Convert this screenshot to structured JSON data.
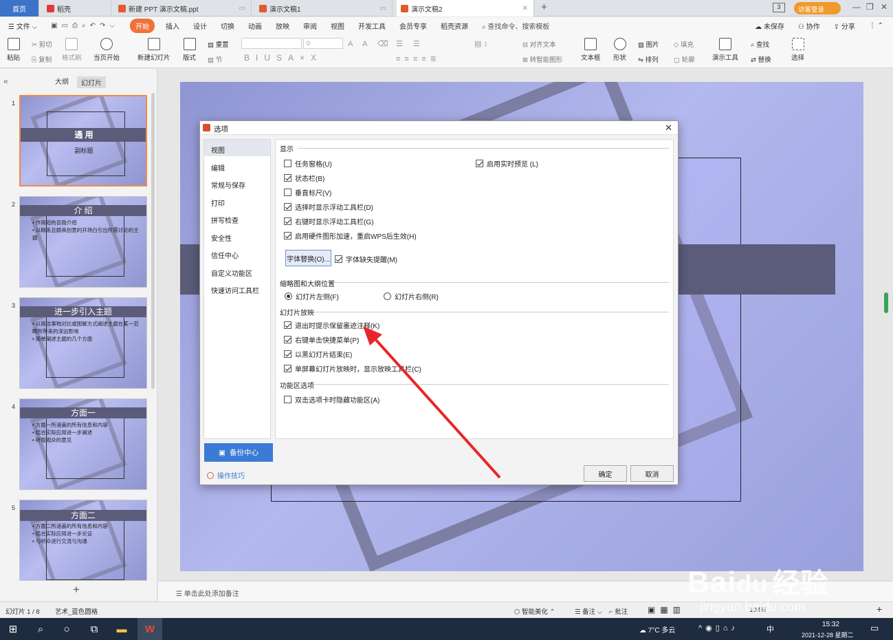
{
  "tabs": [
    {
      "label": "首页"
    },
    {
      "label": "稻壳"
    },
    {
      "label": "新建 PPT 演示文稿.ppt"
    },
    {
      "label": "演示文稿1"
    },
    {
      "label": "演示文稿2"
    }
  ],
  "tabbar_right": {
    "page_badge": "3",
    "login": "访客登录"
  },
  "menu": {
    "file": "文件",
    "tabs": [
      "开始",
      "插入",
      "设计",
      "切换",
      "动画",
      "放映",
      "审阅",
      "视图",
      "开发工具",
      "会员专享",
      "稻壳资源"
    ],
    "search": "查找命令、搜索模板",
    "unsaved": "未保存",
    "collab": "协作",
    "share": "分享"
  },
  "ribbon": {
    "paste": "粘贴",
    "cut": "剪切",
    "copy": "复制",
    "format_painter": "格式刷",
    "from_current": "当页开始",
    "new_slide": "新建幻灯片",
    "layout": "版式",
    "section": "节",
    "reset": "重置",
    "font_size": "0",
    "align_text": "对齐文本",
    "smartart": "转智能图形",
    "textbox": "文本框",
    "shape": "形状",
    "picture": "图片",
    "fill": "填充",
    "arrange": "排列",
    "outline": "轮廓",
    "present_tool": "演示工具",
    "find": "查找",
    "replace": "替换",
    "select": "选择"
  },
  "leftpanel": {
    "tab_outline": "大纲",
    "tab_slides": "幻灯片"
  },
  "thumbs": [
    {
      "num": "1",
      "title": "通 用",
      "subtitle": "副标题"
    },
    {
      "num": "2",
      "title": "介 绍",
      "b1": "• 作简短的自我介绍",
      "b2": "• 以精练且颇具创意的开场白引出所需讨论的主题"
    },
    {
      "num": "3",
      "title": "进一步引入主题",
      "b1": "• 以简洁事物对比或图解方式阐述主题在某一范畴所带来的深远影响",
      "b2": "• 简单阐述主题的几个方面"
    },
    {
      "num": "4",
      "title": "方面一",
      "b1": "• 方面一所涵盖的所有信息和内容",
      "b2": "• 结合实际应用进一步阐述",
      "b3": "• 听取观众的意见"
    },
    {
      "num": "5",
      "title": "方面二",
      "b1": "• 方面二所涵盖的所有信息和内容",
      "b2": "• 结合实际应用进一步论证",
      "b3": "• 与听众进行交流与沟通"
    }
  ],
  "notes": "单击此处添加备注",
  "status": {
    "slide": "幻灯片 1 / 8",
    "theme": "艺术_蓝色圆格",
    "beautify": "智能美化",
    "notes": "备注",
    "comment": "批注",
    "zoom": "104%"
  },
  "dialog": {
    "title": "选项",
    "nav": [
      "视图",
      "编辑",
      "常规与保存",
      "打印",
      "拼写检查",
      "安全性",
      "信任中心",
      "自定义功能区",
      "快速访问工具栏"
    ],
    "sections": {
      "display": "显示",
      "thumb_pos": "缩略图和大纲位置",
      "slideshow": "幻灯片放映",
      "ribbon_opts": "功能区选项"
    },
    "options": {
      "task_pane": "任务窗格(U)",
      "status_bar": "状态栏(B)",
      "vertical_ruler": "垂直标尺(V)",
      "float_on_select": "选择时显示浮动工具栏(D)",
      "float_on_right": "右键时显示浮动工具栏(G)",
      "hw_accel": "启用硬件图形加速，重启WPS后生效(H)",
      "live_preview": "启用实时预览 (L)",
      "font_missing": "字体缺失提醒(M)",
      "left": "幻灯片左侧(F)",
      "right": "幻灯片右侧(R)",
      "keep_ink": "退出时提示保留墨迹注释(K)",
      "right_menu": "右键单击快捷菜单(P)",
      "end_black": "以黑幻灯片结束(E)",
      "single_screen": "单屏幕幻灯片放映时，显示放映工具栏(C)",
      "dbl_hide": "双击选项卡时隐藏功能区(A)"
    },
    "font_replace_btn": "字体替换(O)...",
    "backup": "备份中心",
    "tips": "操作技巧",
    "ok": "确定",
    "cancel": "取消"
  },
  "taskbar": {
    "weather": "7°C 多云",
    "ime": "中",
    "time": "15:32",
    "date": "2021-12-28 星期二"
  },
  "watermark": {
    "brand": "Bai",
    "brand2": "du",
    "jy": "经验",
    "url": "jingyan.baidu.com"
  }
}
